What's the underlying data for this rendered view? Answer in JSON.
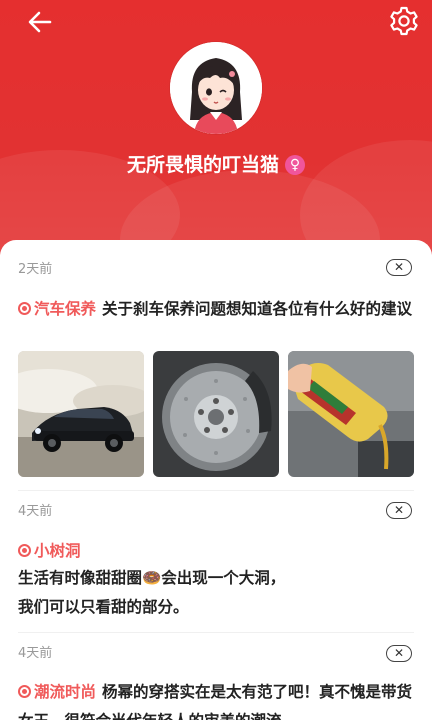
{
  "profile": {
    "username": "无所畏惧的叮当猫",
    "gender_symbol": "♀",
    "accent_color": "#e52f2f"
  },
  "header": {
    "back_icon": "back-arrow-icon",
    "settings_icon": "gear-icon"
  },
  "posts": [
    {
      "time": "2天前",
      "topic": "汽车保养",
      "text": "关于刹车保养问题想知道各位有什么好的建议",
      "images": [
        "drifting-car-image",
        "brake-disc-image",
        "engine-oil-image"
      ]
    },
    {
      "time": "4天前",
      "topic": "小树洞",
      "text_line1": "生活有时像甜甜圈🍩会出现一个大洞，",
      "text_line2": "我们可以只看甜的部分。"
    },
    {
      "time": "4天前",
      "topic": "潮流时尚",
      "text": "杨幂的穿搭实在是太有范了吧！真不愧是带货女王，很符合当代年轻人的审美的潮流"
    }
  ],
  "close_symbol": "✕"
}
